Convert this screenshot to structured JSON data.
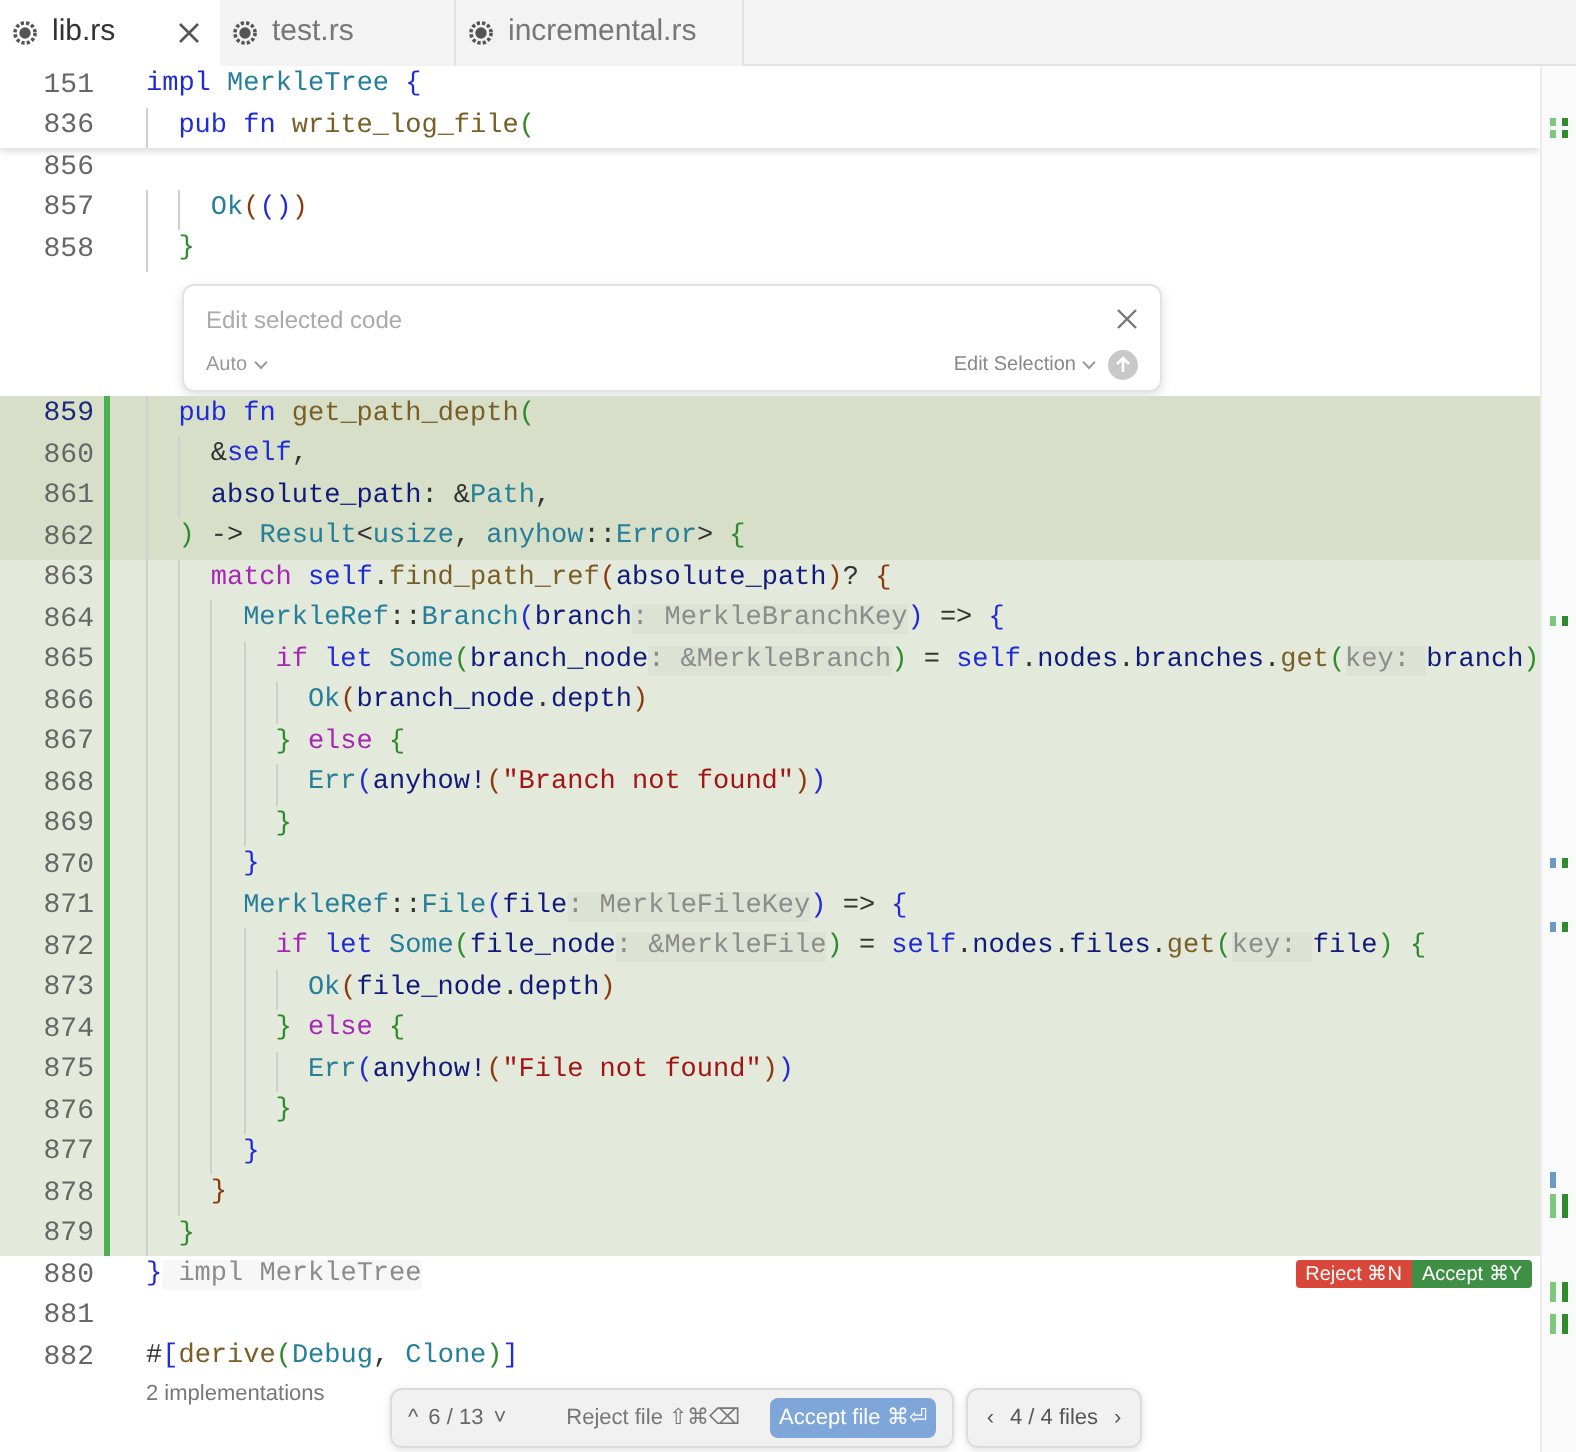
{
  "tabs": [
    {
      "label": "lib.rs",
      "selected": true,
      "closable": true
    },
    {
      "label": "test.rs",
      "selected": false,
      "closable": false
    },
    {
      "label": "incremental.rs",
      "selected": false,
      "closable": false
    }
  ],
  "sticky_scroll": [
    {
      "number": "151",
      "tokens": [
        {
          "kind": "keyword",
          "text": "impl "
        },
        {
          "kind": "type",
          "text": "MerkleTree "
        },
        {
          "kind": "bracket2",
          "text": "{"
        }
      ]
    },
    {
      "number": "836",
      "tokens": [
        {
          "kind": "keyword",
          "text": "  pub fn "
        },
        {
          "kind": "function",
          "text": "write_log_file"
        },
        {
          "kind": "bracket3",
          "text": "("
        }
      ]
    }
  ],
  "lines_before": [
    {
      "number": "856"
    },
    {
      "number": "857",
      "tokens": [
        {
          "kind": "type",
          "text": "    Ok"
        },
        {
          "kind": "bracket1",
          "text": "("
        },
        {
          "kind": "bracket2",
          "text": "()"
        },
        {
          "kind": "bracket1",
          "text": ")"
        }
      ]
    },
    {
      "number": "858",
      "tokens": [
        {
          "kind": "bracket3",
          "text": "  }"
        }
      ]
    }
  ],
  "edit_popup": {
    "placeholder": "Edit selected code",
    "model": "Auto",
    "mode": "Edit Selection",
    "send_disabled": true
  },
  "lines": [
    {
      "number": "859",
      "current": true,
      "added": true,
      "selected": true,
      "tokens": [
        {
          "kind": "keyword",
          "text": "  pub fn "
        },
        {
          "kind": "function",
          "text": "get_path_depth"
        },
        {
          "kind": "bracket3",
          "text": "("
        }
      ]
    },
    {
      "number": "860",
      "current": false,
      "added": true,
      "selected": true,
      "tokens": [
        {
          "kind": "plain",
          "text": "    &"
        },
        {
          "kind": "keyword",
          "text": "self"
        },
        {
          "kind": "plain",
          "text": ","
        }
      ]
    },
    {
      "number": "861",
      "current": false,
      "added": true,
      "selected": true,
      "tokens": [
        {
          "kind": "variable",
          "text": "    absolute_path"
        },
        {
          "kind": "plain",
          "text": ": &"
        },
        {
          "kind": "type",
          "text": "Path"
        },
        {
          "kind": "plain",
          "text": ","
        }
      ]
    },
    {
      "number": "862",
      "current": false,
      "added": true,
      "selected": true,
      "tokens": [
        {
          "kind": "bracket3",
          "text": "  )"
        },
        {
          "kind": "plain",
          "text": " -> "
        },
        {
          "kind": "type",
          "text": "Result"
        },
        {
          "kind": "plain",
          "text": "<"
        },
        {
          "kind": "type",
          "text": "usize"
        },
        {
          "kind": "plain",
          "text": ", "
        },
        {
          "kind": "type",
          "text": "anyhow"
        },
        {
          "kind": "plain",
          "text": "::"
        },
        {
          "kind": "type",
          "text": "Error"
        },
        {
          "kind": "plain",
          "text": "> "
        },
        {
          "kind": "bracket3",
          "text": "{"
        }
      ]
    },
    {
      "number": "863",
      "current": false,
      "added": true,
      "selected": false,
      "tokens": [
        {
          "kind": "control",
          "text": "    match "
        },
        {
          "kind": "keyword",
          "text": "self"
        },
        {
          "kind": "plain",
          "text": "."
        },
        {
          "kind": "function",
          "text": "find_path_ref"
        },
        {
          "kind": "bracket1",
          "text": "("
        },
        {
          "kind": "variable",
          "text": "absolute_path"
        },
        {
          "kind": "bracket1",
          "text": ")"
        },
        {
          "kind": "plain",
          "text": "? "
        },
        {
          "kind": "bracket1",
          "text": "{"
        }
      ]
    },
    {
      "number": "864",
      "current": false,
      "added": true,
      "selected": false,
      "tokens": [
        {
          "kind": "type",
          "text": "      MerkleRef"
        },
        {
          "kind": "plain",
          "text": "::"
        },
        {
          "kind": "type",
          "text": "Branch"
        },
        {
          "kind": "bracket2",
          "text": "("
        },
        {
          "kind": "variable",
          "text": "branch"
        },
        {
          "kind": "hint",
          "text": ": MerkleBranchKey"
        },
        {
          "kind": "bracket2",
          "text": ")"
        },
        {
          "kind": "plain",
          "text": " => "
        },
        {
          "kind": "bracket2",
          "text": "{"
        }
      ]
    },
    {
      "number": "865",
      "current": false,
      "added": true,
      "selected": false,
      "tokens": [
        {
          "kind": "control",
          "text": "        if "
        },
        {
          "kind": "keyword",
          "text": "let "
        },
        {
          "kind": "type",
          "text": "Some"
        },
        {
          "kind": "bracket3",
          "text": "("
        },
        {
          "kind": "variable",
          "text": "branch_node"
        },
        {
          "kind": "hint",
          "text": ": &MerkleBranch"
        },
        {
          "kind": "bracket3",
          "text": ")"
        },
        {
          "kind": "plain",
          "text": " = "
        },
        {
          "kind": "keyword",
          "text": "self"
        },
        {
          "kind": "plain",
          "text": "."
        },
        {
          "kind": "variable",
          "text": "nodes"
        },
        {
          "kind": "plain",
          "text": "."
        },
        {
          "kind": "variable",
          "text": "branches"
        },
        {
          "kind": "plain",
          "text": "."
        },
        {
          "kind": "function",
          "text": "get"
        },
        {
          "kind": "bracket3",
          "text": "("
        },
        {
          "kind": "hint",
          "text": "key: "
        },
        {
          "kind": "variable",
          "text": "branch"
        },
        {
          "kind": "bracket3",
          "text": ")"
        }
      ]
    },
    {
      "number": "866",
      "current": false,
      "added": true,
      "selected": false,
      "tokens": [
        {
          "kind": "type",
          "text": "          Ok"
        },
        {
          "kind": "bracket1",
          "text": "("
        },
        {
          "kind": "variable",
          "text": "branch_node"
        },
        {
          "kind": "plain",
          "text": "."
        },
        {
          "kind": "variable",
          "text": "depth"
        },
        {
          "kind": "bracket1",
          "text": ")"
        }
      ]
    },
    {
      "number": "867",
      "current": false,
      "added": true,
      "selected": false,
      "tokens": [
        {
          "kind": "bracket3",
          "text": "        } "
        },
        {
          "kind": "control",
          "text": "else "
        },
        {
          "kind": "bracket3",
          "text": "{"
        }
      ]
    },
    {
      "number": "868",
      "current": false,
      "added": true,
      "selected": false,
      "tokens": [
        {
          "kind": "type",
          "text": "          Err"
        },
        {
          "kind": "bracket2",
          "text": "("
        },
        {
          "kind": "variable",
          "text": "anyhow!"
        },
        {
          "kind": "bracket1",
          "text": "("
        },
        {
          "kind": "string",
          "text": "\"Branch not found\""
        },
        {
          "kind": "bracket1",
          "text": ")"
        },
        {
          "kind": "bracket2",
          "text": ")"
        }
      ]
    },
    {
      "number": "869",
      "current": false,
      "added": true,
      "selected": false,
      "tokens": [
        {
          "kind": "bracket3",
          "text": "        }"
        }
      ]
    },
    {
      "number": "870",
      "current": false,
      "added": true,
      "selected": false,
      "tokens": [
        {
          "kind": "bracket2",
          "text": "      }"
        }
      ]
    },
    {
      "number": "871",
      "current": false,
      "added": true,
      "selected": false,
      "tokens": [
        {
          "kind": "type",
          "text": "      MerkleRef"
        },
        {
          "kind": "plain",
          "text": "::"
        },
        {
          "kind": "type",
          "text": "File"
        },
        {
          "kind": "bracket2",
          "text": "("
        },
        {
          "kind": "variable",
          "text": "file"
        },
        {
          "kind": "hint",
          "text": ": MerkleFileKey"
        },
        {
          "kind": "bracket2",
          "text": ")"
        },
        {
          "kind": "plain",
          "text": " => "
        },
        {
          "kind": "bracket2",
          "text": "{"
        }
      ]
    },
    {
      "number": "872",
      "current": false,
      "added": true,
      "selected": false,
      "tokens": [
        {
          "kind": "control",
          "text": "        if "
        },
        {
          "kind": "keyword",
          "text": "let "
        },
        {
          "kind": "type",
          "text": "Some"
        },
        {
          "kind": "bracket3",
          "text": "("
        },
        {
          "kind": "variable",
          "text": "file_node"
        },
        {
          "kind": "hint",
          "text": ": &MerkleFile"
        },
        {
          "kind": "bracket3",
          "text": ")"
        },
        {
          "kind": "plain",
          "text": " = "
        },
        {
          "kind": "keyword",
          "text": "self"
        },
        {
          "kind": "plain",
          "text": "."
        },
        {
          "kind": "variable",
          "text": "nodes"
        },
        {
          "kind": "plain",
          "text": "."
        },
        {
          "kind": "variable",
          "text": "files"
        },
        {
          "kind": "plain",
          "text": "."
        },
        {
          "kind": "function",
          "text": "get"
        },
        {
          "kind": "bracket3",
          "text": "("
        },
        {
          "kind": "hint",
          "text": "key: "
        },
        {
          "kind": "variable",
          "text": "file"
        },
        {
          "kind": "bracket3",
          "text": ")"
        },
        {
          "kind": "bracket3",
          "text": " {"
        }
      ]
    },
    {
      "number": "873",
      "current": false,
      "added": true,
      "selected": false,
      "tokens": [
        {
          "kind": "type",
          "text": "          Ok"
        },
        {
          "kind": "bracket1",
          "text": "("
        },
        {
          "kind": "variable",
          "text": "file_node"
        },
        {
          "kind": "plain",
          "text": "."
        },
        {
          "kind": "variable",
          "text": "depth"
        },
        {
          "kind": "bracket1",
          "text": ")"
        }
      ]
    },
    {
      "number": "874",
      "current": false,
      "added": true,
      "selected": false,
      "tokens": [
        {
          "kind": "bracket3",
          "text": "        } "
        },
        {
          "kind": "control",
          "text": "else "
        },
        {
          "kind": "bracket3",
          "text": "{"
        }
      ]
    },
    {
      "number": "875",
      "current": false,
      "added": true,
      "selected": false,
      "tokens": [
        {
          "kind": "type",
          "text": "          Err"
        },
        {
          "kind": "bracket2",
          "text": "("
        },
        {
          "kind": "variable",
          "text": "anyhow!"
        },
        {
          "kind": "bracket1",
          "text": "("
        },
        {
          "kind": "string",
          "text": "\"File not found\""
        },
        {
          "kind": "bracket1",
          "text": ")"
        },
        {
          "kind": "bracket2",
          "text": ")"
        }
      ]
    },
    {
      "number": "876",
      "current": false,
      "added": true,
      "selected": false,
      "tokens": [
        {
          "kind": "bracket3",
          "text": "        }"
        }
      ]
    },
    {
      "number": "877",
      "current": false,
      "added": true,
      "selected": false,
      "tokens": [
        {
          "kind": "bracket2",
          "text": "      }"
        }
      ]
    },
    {
      "number": "878",
      "current": false,
      "added": true,
      "selected": false,
      "tokens": [
        {
          "kind": "bracket1",
          "text": "    }"
        }
      ]
    },
    {
      "number": "879",
      "current": false,
      "added": true,
      "selected": false,
      "tokens": [
        {
          "kind": "bracket3",
          "text": "  }"
        }
      ]
    },
    {
      "number": "880",
      "current": false,
      "added": false,
      "selected": false,
      "tokens": [
        {
          "kind": "bracket2",
          "text": "}"
        },
        {
          "kind": "hint",
          "text": " impl MerkleTree"
        }
      ]
    },
    {
      "number": "881",
      "current": false,
      "added": false,
      "selected": false
    },
    {
      "number": "882",
      "current": false,
      "added": false,
      "selected": false,
      "tokens": [
        {
          "kind": "plain",
          "text": "#"
        },
        {
          "kind": "bracket2",
          "text": "["
        },
        {
          "kind": "function",
          "text": "derive"
        },
        {
          "kind": "bracket3",
          "text": "("
        },
        {
          "kind": "type",
          "text": "Debug"
        },
        {
          "kind": "plain",
          "text": ", "
        },
        {
          "kind": "type",
          "text": "Clone"
        },
        {
          "kind": "bracket3",
          "text": ")"
        },
        {
          "kind": "bracket2",
          "text": "]"
        }
      ],
      "codelens": "2 implementations"
    }
  ],
  "hunk_actions": {
    "reject": "Reject ⌘N",
    "accept": "Accept ⌘Y"
  },
  "review_bar": {
    "up": "^",
    "counter": "6 / 13",
    "down": "˅",
    "reject_file": "Reject file",
    "reject_shortcut": "⇧⌘⌫",
    "accept_file": "Accept file",
    "accept_shortcut": "⌘⏎",
    "prev": "‹",
    "files": "4 / 4 files",
    "next": "›"
  }
}
